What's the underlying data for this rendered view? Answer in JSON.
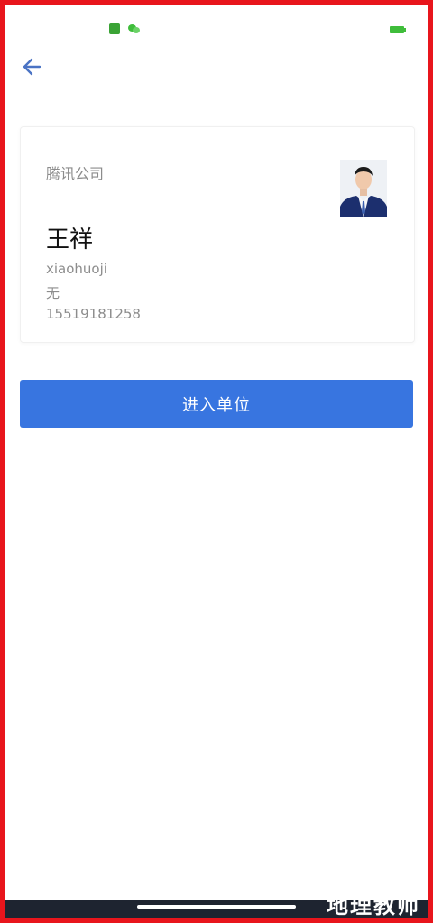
{
  "status_bar": {
    "notification_icons": [
      "app-notification-icon",
      "wechat-icon"
    ],
    "battery_icon": "battery-icon"
  },
  "header": {
    "back_icon": "arrow-left-icon"
  },
  "card": {
    "company": "腾讯公司",
    "name": "王祥",
    "username": "xiaohuoji",
    "department": "无",
    "phone": "15519181258"
  },
  "actions": {
    "enter_label": "进入单位"
  },
  "watermark": {
    "text": "地理教师"
  },
  "colors": {
    "primary": "#3875e0",
    "back_icon": "#4a73c4",
    "frame": "#e8151c"
  }
}
